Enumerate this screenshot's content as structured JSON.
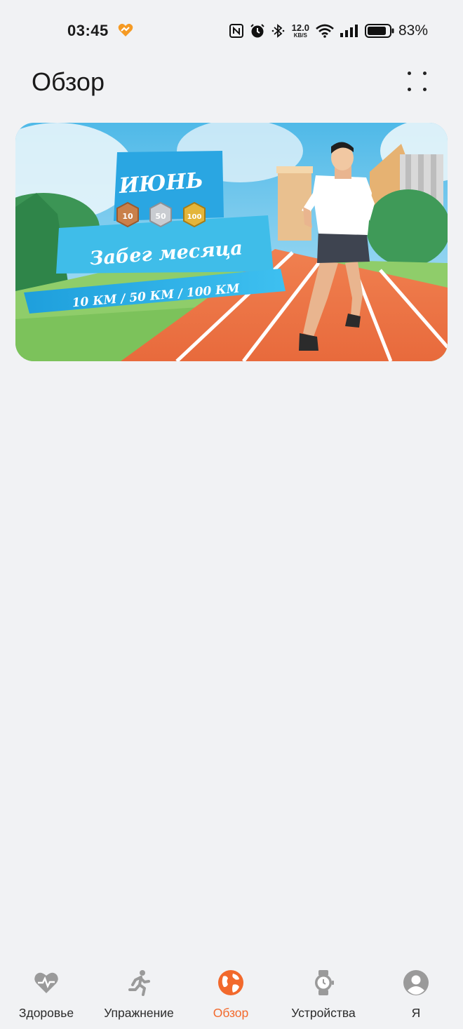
{
  "status_bar": {
    "time": "03:45",
    "net_speed_value": "12.0",
    "net_speed_unit": "KB/S",
    "battery_percent": "83%"
  },
  "header": {
    "title": "Обзор"
  },
  "banner": {
    "title": "ИЮНЬ",
    "medals": [
      "10",
      "50",
      "100"
    ],
    "subtitle": "Забег месяца",
    "distances": "10 КМ / 50 КМ / 100 КМ"
  },
  "bottom_nav": {
    "items": [
      {
        "label": "Здоровье",
        "icon": "heart-pulse-icon",
        "active": false
      },
      {
        "label": "Упражнение",
        "icon": "running-person-icon",
        "active": false
      },
      {
        "label": "Обзор",
        "icon": "globe-icon",
        "active": true
      },
      {
        "label": "Устройства",
        "icon": "watch-icon",
        "active": false
      },
      {
        "label": "Я",
        "icon": "profile-icon",
        "active": false
      }
    ]
  },
  "colors": {
    "accent": "#f2692c",
    "background": "#f1f2f4",
    "inactive_icon": "#9a9a9a"
  }
}
